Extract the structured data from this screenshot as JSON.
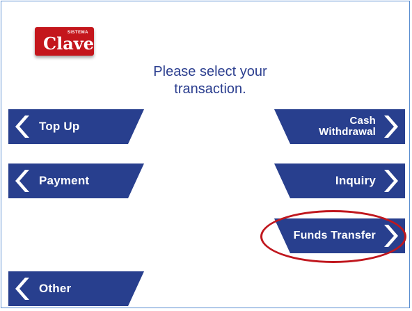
{
  "logo": {
    "top_text": "SISTEMA",
    "main_text": "Clave"
  },
  "prompt": {
    "line1": "Please select your",
    "line2": "transaction."
  },
  "left_buttons": [
    {
      "label": "Top Up"
    },
    {
      "label": "Payment"
    },
    {
      "label": "Other"
    }
  ],
  "right_buttons": [
    {
      "label_line1": "Cash",
      "label_line2": "Withdrawal"
    },
    {
      "label": "Inquiry"
    },
    {
      "label": "Funds Transfer"
    }
  ],
  "colors": {
    "button": "#283f8e",
    "prompt": "#2b3e8f",
    "logo": "#c4161c",
    "highlight": "#c0171e"
  }
}
